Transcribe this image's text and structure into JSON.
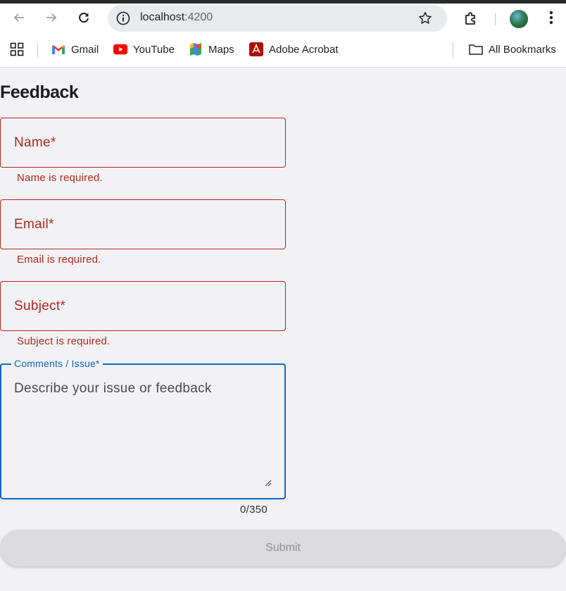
{
  "browser": {
    "url_host": "localhost",
    "url_port": ":4200",
    "bookmarks": [
      {
        "label": "Gmail",
        "icon": "gmail-icon"
      },
      {
        "label": "YouTube",
        "icon": "youtube-icon"
      },
      {
        "label": "Maps",
        "icon": "maps-icon"
      },
      {
        "label": "Adobe Acrobat",
        "icon": "acrobat-icon"
      }
    ],
    "all_bookmarks": "All Bookmarks"
  },
  "form": {
    "title": "Feedback",
    "fields": [
      {
        "label": "Name*",
        "error": "Name is required."
      },
      {
        "label": "Email*",
        "error": "Email is required."
      },
      {
        "label": "Subject*",
        "error": "Subject is required."
      }
    ],
    "comments": {
      "label": "Comments / Issue*",
      "placeholder": "Describe your issue or feedback",
      "counter": "0/350"
    },
    "submit_label": "Submit"
  },
  "colors": {
    "error": "#b3261e",
    "focus": "#1565c0",
    "disabled_button": "#dcdcde"
  }
}
